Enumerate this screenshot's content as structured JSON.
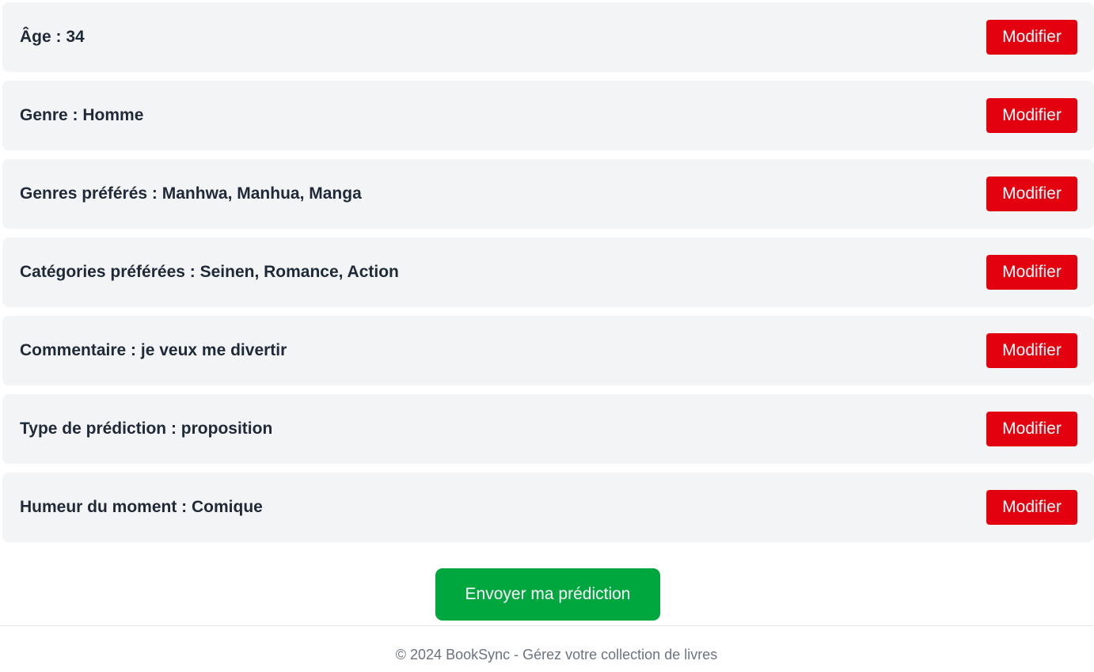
{
  "summary": {
    "rows": [
      {
        "text": "Âge : 34",
        "button_label": "Modifier"
      },
      {
        "text": "Genre : Homme",
        "button_label": "Modifier"
      },
      {
        "text": "Genres préférés : Manhwa, Manhua, Manga",
        "button_label": "Modifier"
      },
      {
        "text": "Catégories préférées : Seinen, Romance, Action",
        "button_label": "Modifier"
      },
      {
        "text": "Commentaire : je veux me divertir",
        "button_label": "Modifier"
      },
      {
        "text": "Type de prédiction : proposition",
        "button_label": "Modifier"
      },
      {
        "text": "Humeur du moment : Comique",
        "button_label": "Modifier"
      }
    ]
  },
  "submit": {
    "label": "Envoyer ma prédiction"
  },
  "footer": {
    "text": "© 2024 BookSync - Gérez votre collection de livres"
  },
  "colors": {
    "row_background": "#f3f4f6",
    "edit_button": "#e3000f",
    "submit_button": "#00a63e",
    "text": "#1f2937",
    "footer_text": "#6b7280"
  }
}
